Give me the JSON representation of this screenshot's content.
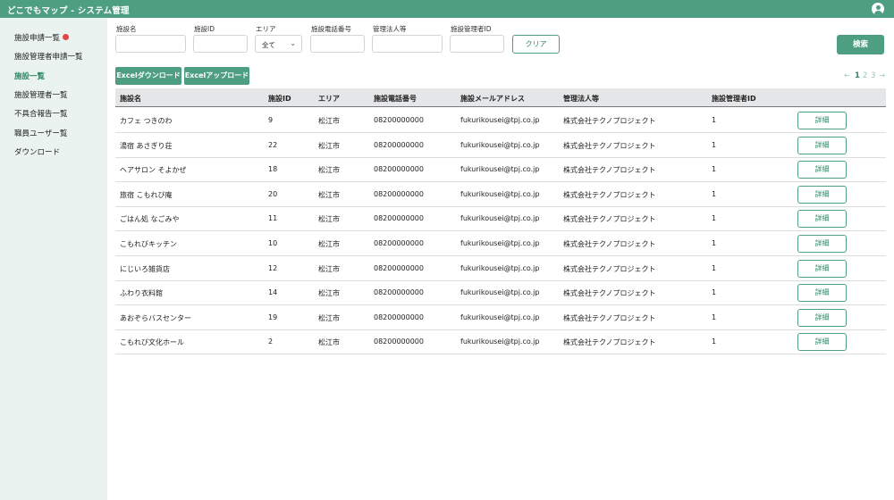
{
  "app": {
    "title": "どこでもマップ - システム管理"
  },
  "sidebar": {
    "items": [
      {
        "label": "施設申請一覧",
        "badge": true
      },
      {
        "label": "施設管理者申請一覧"
      },
      {
        "label": "施設一覧",
        "active": true
      },
      {
        "label": "施設管理者一覧"
      },
      {
        "label": "不具合報告一覧"
      },
      {
        "label": "職員ユーザー覧"
      },
      {
        "label": "ダウンロード"
      }
    ]
  },
  "filters": {
    "name_label": "施設名",
    "id_label": "施設ID",
    "area_label": "エリア",
    "area_value": "全て",
    "phone_label": "施設電話番号",
    "corp_label": "管理法人等",
    "manager_label": "施設管理者ID",
    "clear_label": "クリア",
    "search_label": "検索"
  },
  "actions": {
    "excel_download": "Excelダウンロード",
    "excel_upload": "Excelアップロード"
  },
  "pagination": {
    "prev": "←",
    "pages": [
      "1",
      "2",
      "3"
    ],
    "current": "1",
    "next": "→"
  },
  "table": {
    "headers": [
      "施設名",
      "施設ID",
      "エリア",
      "施設電話番号",
      "施設メールアドレス",
      "管理法人等",
      "施設管理者ID"
    ],
    "detail_label": "詳細",
    "rows": [
      [
        "カフェ つきのわ",
        "9",
        "松江市",
        "08200000000",
        "fukurikousei@tpj.co.jp",
        "株式会社テクノプロジェクト",
        "1"
      ],
      [
        "湯宿 あさぎり荘",
        "22",
        "松江市",
        "08200000000",
        "fukurikousei@tpj.co.jp",
        "株式会社テクノプロジェクト",
        "1"
      ],
      [
        "ヘアサロン そよかぜ",
        "18",
        "松江市",
        "08200000000",
        "fukurikousei@tpj.co.jp",
        "株式会社テクノプロジェクト",
        "1"
      ],
      [
        "旅宿 こもれび庵",
        "20",
        "松江市",
        "08200000000",
        "fukurikousei@tpj.co.jp",
        "株式会社テクノプロジェクト",
        "1"
      ],
      [
        "ごはん処 なごみや",
        "11",
        "松江市",
        "08200000000",
        "fukurikousei@tpj.co.jp",
        "株式会社テクノプロジェクト",
        "1"
      ],
      [
        "こもれびキッチン",
        "10",
        "松江市",
        "08200000000",
        "fukurikousei@tpj.co.jp",
        "株式会社テクノプロジェクト",
        "1"
      ],
      [
        "にじいろ雑貨店",
        "12",
        "松江市",
        "08200000000",
        "fukurikousei@tpj.co.jp",
        "株式会社テクノプロジェクト",
        "1"
      ],
      [
        "ふわり衣料館",
        "14",
        "松江市",
        "08200000000",
        "fukurikousei@tpj.co.jp",
        "株式会社テクノプロジェクト",
        "1"
      ],
      [
        "あおぞらバスセンター",
        "19",
        "松江市",
        "08200000000",
        "fukurikousei@tpj.co.jp",
        "株式会社テクノプロジェクト",
        "1"
      ],
      [
        "こもれび文化ホール",
        "2",
        "松江市",
        "08200000000",
        "fukurikousei@tpj.co.jp",
        "株式会社テクノプロジェクト",
        "1"
      ]
    ]
  },
  "colors": {
    "brand": "#4e9e82",
    "badge": "#e04848",
    "sidebar_bg": "#eaf3ef"
  }
}
